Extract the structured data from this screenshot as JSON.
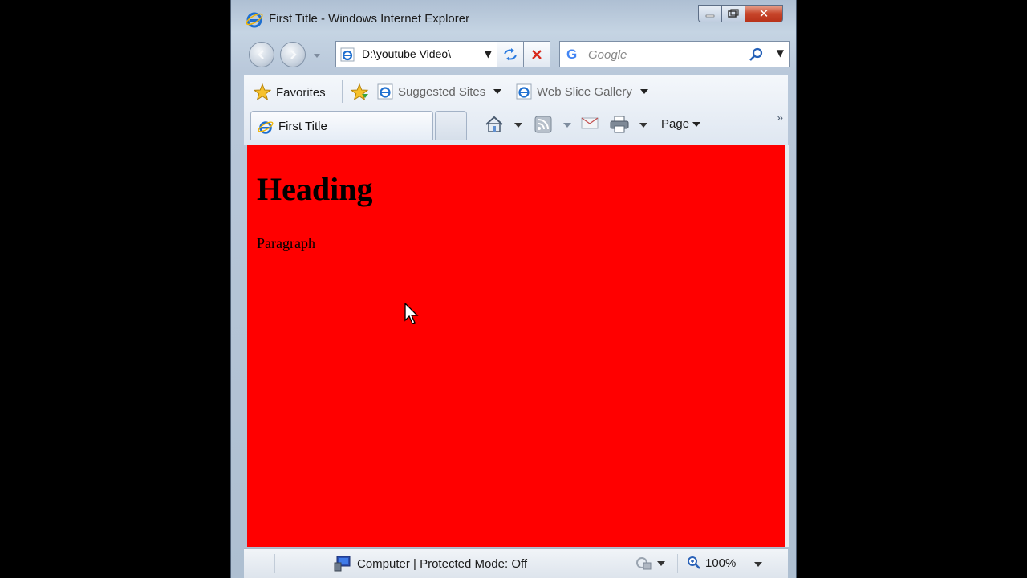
{
  "window": {
    "title": "First Title - Windows Internet Explorer",
    "caption": {
      "close_glyph": "✕"
    }
  },
  "navigation": {
    "address": "D:\\youtube Video\\",
    "search_placeholder": "Google",
    "search_brand": "G"
  },
  "favorites_bar": {
    "favorites_label": "Favorites",
    "suggested_sites": "Suggested Sites",
    "web_slice_gallery": "Web Slice Gallery"
  },
  "command_bar": {
    "tab_title": "First Title",
    "page_menu": "Page",
    "overflow": "»"
  },
  "document": {
    "heading": "Heading",
    "paragraph": "Paragraph",
    "background": "#ff0000"
  },
  "status_bar": {
    "zone": "Computer | Protected Mode: Off",
    "zoom": "100%"
  },
  "colors": {
    "page_background": "#000000",
    "close_button": "#c7452a",
    "link_blue": "#1e6fd0"
  }
}
